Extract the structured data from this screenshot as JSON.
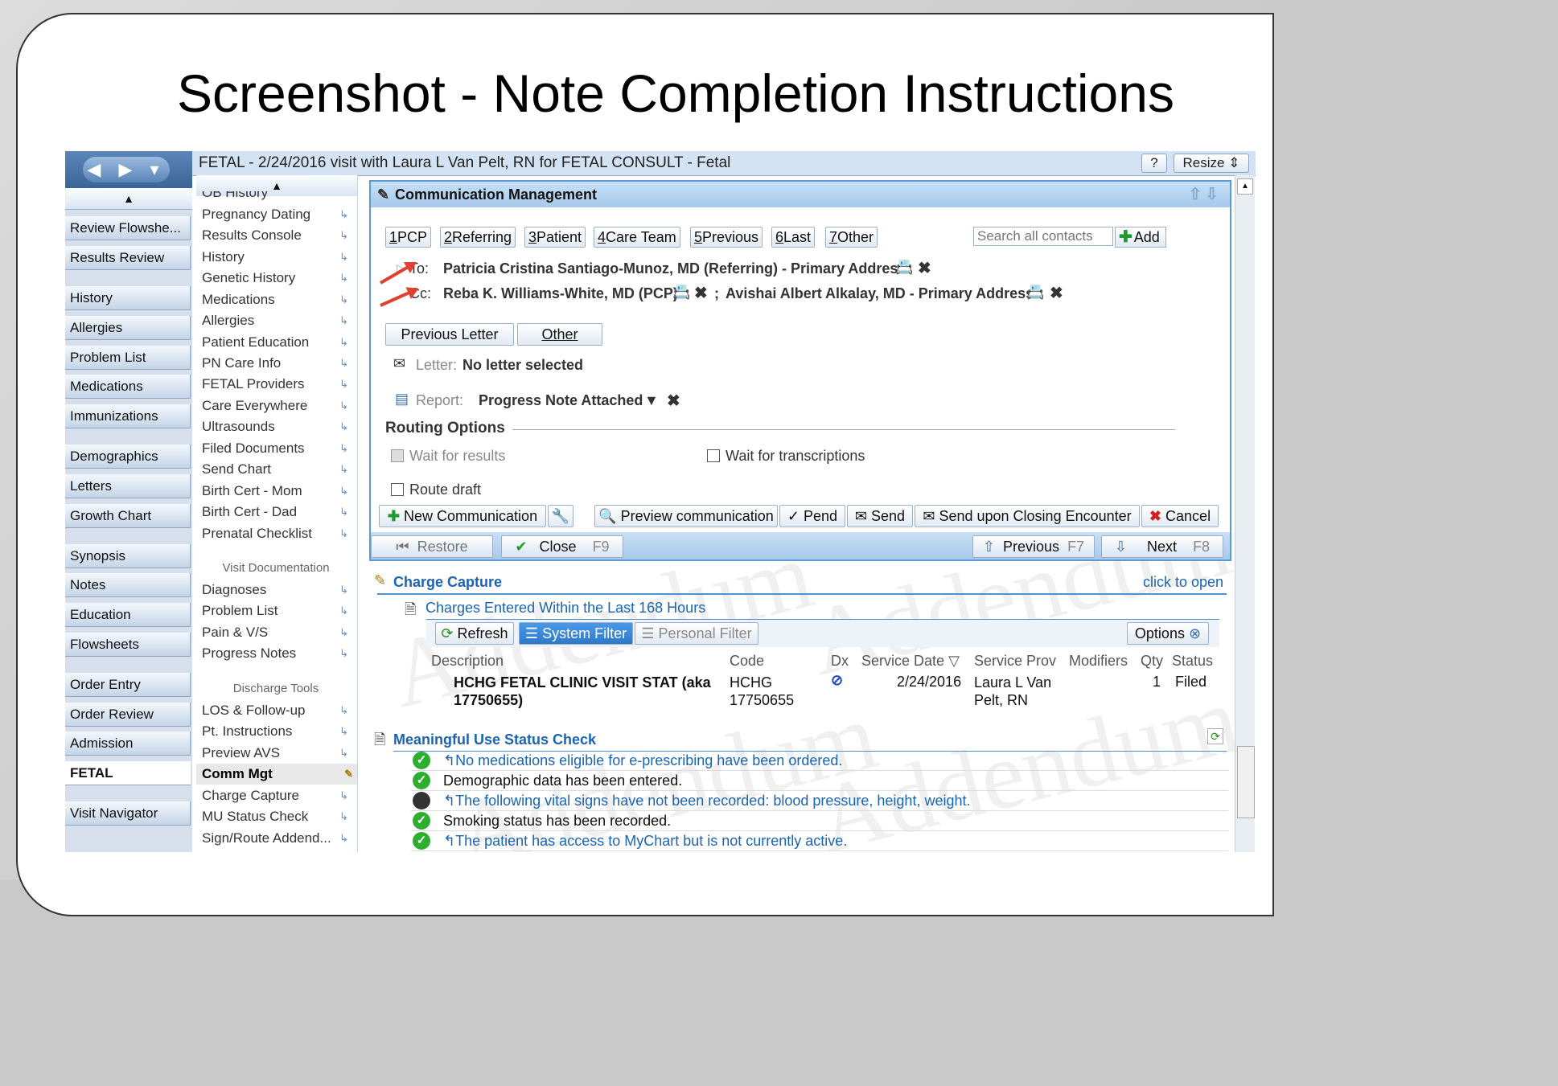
{
  "slide_title": "Screenshot - Note Completion Instructions",
  "header": {
    "title": "FETAL - 2/24/2016 visit with Laura L Van Pelt, RN for FETAL CONSULT - Fetal",
    "help": "?",
    "resize": "Resize"
  },
  "nav": {
    "items": [
      "Review Flowshe...",
      "Results Review",
      "History",
      "Allergies",
      "Problem List",
      "Medications",
      "Immunizations",
      "Demographics",
      "Letters",
      "Growth Chart",
      "Synopsis",
      "Notes",
      "Education",
      "Flowsheets",
      "Order Entry",
      "Order Review",
      "Admission",
      "FETAL",
      "Visit Navigator"
    ]
  },
  "menu": {
    "items": [
      "OB History",
      "Pregnancy Dating",
      "Results Console",
      "History",
      "Genetic History",
      "Medications",
      "Allergies",
      "Patient Education",
      "PN Care Info",
      "FETAL Providers",
      "Care Everywhere",
      "Ultrasounds",
      "Filed Documents",
      "Send Chart",
      "Birth Cert - Mom",
      "Birth Cert - Dad",
      "Prenatal Checklist"
    ],
    "visit_header": "Visit Documentation",
    "visit_items": [
      "Diagnoses",
      "Problem List",
      "Pain & V/S",
      "Progress Notes"
    ],
    "discharge_header": "Discharge Tools",
    "discharge_items": [
      "LOS & Follow-up",
      "Pt. Instructions",
      "Preview AVS",
      "Comm Mgt",
      "Charge Capture",
      "MU Status Check",
      "Sign/Route Addend..."
    ]
  },
  "comm": {
    "title": "Communication Management",
    "tabs": [
      {
        "num": "1",
        "label": "PCP"
      },
      {
        "num": "2",
        "label": "Referring"
      },
      {
        "num": "3",
        "label": "Patient"
      },
      {
        "num": "4",
        "label": "Care Team"
      },
      {
        "num": "5",
        "label": "Previous"
      },
      {
        "num": "6",
        "label": "Last"
      },
      {
        "num": "7",
        "label": "Other"
      }
    ],
    "search_placeholder": "Search all contacts",
    "add_label": "Add",
    "to_label": "To:",
    "to_value": "Patricia Cristina Santiago-Munoz, MD (Referring) - Primary Address",
    "cc_label": "Cc:",
    "cc_value_1": "Reba K. Williams-White, MD (PCP)",
    "cc_sep": ";",
    "cc_value_2": "Avishai Albert Alkalay, MD - Primary Address",
    "previous_letter": "Previous Letter",
    "other": "Other",
    "letter_label": "Letter:",
    "letter_value": "No letter selected",
    "report_label": "Report:",
    "report_value": "Progress Note Attached",
    "routing_title": "Routing Options",
    "wait_results": "Wait for results",
    "wait_transcriptions": "Wait for transcriptions",
    "route_draft": "Route draft",
    "new_comm": "New Communication",
    "preview": "Preview communication",
    "pend": "Pend",
    "send": "Send",
    "send_closing": "Send upon Closing Encounter",
    "cancel": "Cancel",
    "restore": "Restore",
    "close": "Close",
    "close_key": "F9",
    "previous": "Previous",
    "previous_key": "F7",
    "next": "Next",
    "next_key": "F8"
  },
  "charge": {
    "title": "Charge Capture",
    "open_link": "click to open",
    "subtitle": "Charges Entered Within the Last 168 Hours",
    "refresh": "Refresh",
    "system_filter": "System Filter",
    "personal_filter": "Personal Filter",
    "options": "Options",
    "columns": [
      "Description",
      "Code",
      "Dx",
      "Service Date",
      "Service Prov",
      "Modifiers",
      "Qty",
      "Status"
    ],
    "row": {
      "description": "HCHG FETAL CLINIC VISIT STAT (aka 17750655)",
      "code": "HCHG 17750655",
      "service_date": "2/24/2016",
      "service_prov": "Laura L Van Pelt, RN",
      "qty": "1",
      "status": "Filed"
    }
  },
  "mu": {
    "title": "Meaningful Use Status Check",
    "items": [
      {
        "text": "No medications eligible for e-prescribing have been ordered.",
        "status": "ok",
        "link": true
      },
      {
        "text": "Demographic data has been entered.",
        "status": "ok",
        "link": false
      },
      {
        "text": "The following vital signs have not been recorded: blood pressure, height, weight.",
        "status": "no",
        "link": true
      },
      {
        "text": "Smoking status has been recorded.",
        "status": "ok",
        "link": false
      },
      {
        "text": "The patient has access to MyChart but is not currently active.",
        "status": "ok",
        "link": true
      }
    ]
  },
  "watermark": "Addendum",
  "colors": {
    "accent": "#5b9bd5",
    "link": "#1b64b3",
    "annotation_arrow": "#e0402f",
    "ok": "#2eae2e"
  }
}
